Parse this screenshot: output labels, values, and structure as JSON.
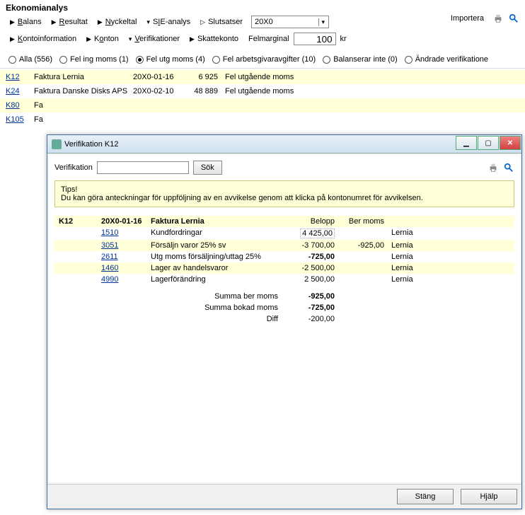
{
  "app_title": "Ekonomianalys",
  "menus1": {
    "balans": "Balans",
    "resultat": "Resultat",
    "nyckeltal": "Nyckeltal",
    "sie": "SIE-analys",
    "slutsatser": "Slutsatser",
    "period_selected": "20X0",
    "importera": "Importera"
  },
  "menus2": {
    "kontoinfo": "Kontoinformation",
    "konton": "Konton",
    "verifikationer": "Verifikationer",
    "skattekonto": "Skattekonto",
    "felmarginal_label": "Felmarginal",
    "felmarginal_value": "100",
    "felmarginal_unit": "kr"
  },
  "filters": {
    "alla": "Alla (556)",
    "fel_ing": "Fel ing moms (1)",
    "fel_utg": "Fel utg moms (4)",
    "fel_arb": "Fel arbetsgivaravgifter (10)",
    "balanserar": "Balanserar inte (0)",
    "andrade": "Ändrade verifikatione"
  },
  "rows": [
    {
      "id": "K12",
      "desc": "Faktura Lernia",
      "date": "20X0-01-16",
      "amount": "6 925",
      "note": "Fel utgående moms"
    },
    {
      "id": "K24",
      "desc": "Faktura Danske Disks APS",
      "date": "20X0-02-10",
      "amount": "48 889",
      "note": "Fel utgående moms"
    },
    {
      "id": "K80",
      "desc": "Fa",
      "date": "",
      "amount": "",
      "note": ""
    },
    {
      "id": "K105",
      "desc": "Fa",
      "date": "",
      "amount": "",
      "note": ""
    }
  ],
  "modal": {
    "title": "Verifikation K12",
    "search_label": "Verifikation",
    "search_btn": "Sök",
    "tip_label": "Tips!",
    "tip_text": "Du kan göra anteckningar för uppföljning av en avvikelse genom att klicka på kontonumret för avvikelsen.",
    "header": {
      "id": "K12",
      "date": "20X0-01-16",
      "desc": "Faktura Lernia",
      "col_belopp": "Belopp",
      "col_bermoms": "Ber moms"
    },
    "lines": [
      {
        "acct": "1510",
        "desc": "Kundfordringar",
        "belopp": "4 425,00",
        "bermoms": "",
        "party": "Lernia",
        "boxed": true
      },
      {
        "acct": "3051",
        "desc": "Försäljn varor 25% sv",
        "belopp": "-3 700,00",
        "bermoms": "-925,00",
        "party": "Lernia"
      },
      {
        "acct": "2611",
        "desc": "Utg moms försäljning/uttag 25%",
        "belopp": "-725,00",
        "bermoms": "",
        "party": "Lernia",
        "bold": true
      },
      {
        "acct": "1460",
        "desc": "Lager av handelsvaror",
        "belopp": "-2 500,00",
        "bermoms": "",
        "party": "Lernia"
      },
      {
        "acct": "4990",
        "desc": "Lagerförändring",
        "belopp": "2 500,00",
        "bermoms": "",
        "party": "Lernia"
      }
    ],
    "sums": {
      "ber_label": "Summa ber moms",
      "ber_val": "-925,00",
      "bok_label": "Summa bokad moms",
      "bok_val": "-725,00",
      "diff_label": "Diff",
      "diff_val": "-200,00"
    },
    "btn_close": "Stäng",
    "btn_help": "Hjälp"
  }
}
